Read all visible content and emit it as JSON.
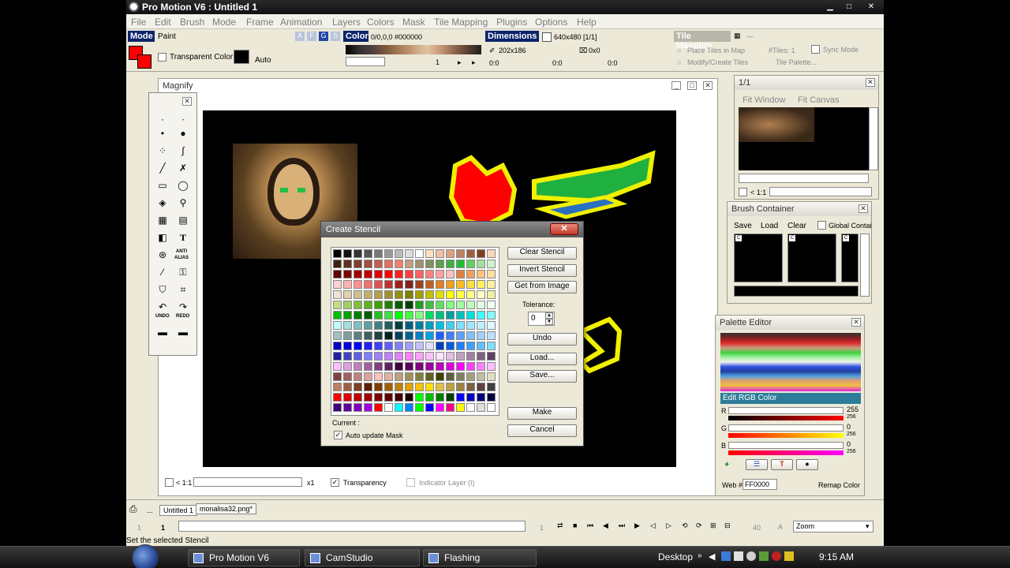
{
  "window": {
    "title": "Pro Motion V6 : Untitled 1",
    "min": "▁",
    "max": "□",
    "close": "✕"
  },
  "menu": [
    "File",
    "Edit",
    "Brush",
    "Mode",
    "Frame",
    "Animation",
    "Layers",
    "Colors",
    "Mask",
    "Tile Mapping",
    "Plugins",
    "Options",
    "Help"
  ],
  "toolbar": {
    "mode_label": "Mode",
    "mode_value": "Paint",
    "mode_letters": [
      "A",
      "F",
      "G",
      "S"
    ],
    "transparent_color_label": "Transparent Color:",
    "auto_label": "Auto",
    "color_label": "Color",
    "color_value": "0/0,0,0 #000000",
    "palette_index": "1",
    "dimensions_label": "Dimensions",
    "dimensions_value": "640x480 [1/1]",
    "brush_size": "202x186",
    "brush_offset": "0x0",
    "coord_a": "0:0",
    "coord_b": "0:0",
    "coord_c": "0:0",
    "tile_mapping_label": "Tile Mapping",
    "tile_dash": "—",
    "place_tiles": "Place Tiles in Map",
    "modify_tiles": "Modify/Create Tiles",
    "tiles_count": "#Tiles: 1",
    "tile_palette": "Tile Palette...",
    "sync_mode": "Sync Mode"
  },
  "magnify": {
    "title": "Magnify",
    "zoom_ratio": "< 1:1",
    "zoom_factor": "x1",
    "transparency_label": "Transparency",
    "indicator_label": "Indicator Layer (I)"
  },
  "tools": {
    "anti_alias_label": "ANTI ALIAS",
    "undo_label": "UNDO",
    "redo_label": "REDO",
    "text_icon": "T"
  },
  "stencil": {
    "title": "Create Stencil",
    "close": "✕",
    "buttons": {
      "clear": "Clear Stencil",
      "invert": "Invert Stencil",
      "get_image": "Get from Image",
      "undo": "Undo",
      "load": "Load...",
      "save": "Save...",
      "make": "Make",
      "cancel": "Cancel"
    },
    "tolerance_label": "Tolerance:",
    "tolerance_value": "0",
    "current_label": "Current :",
    "auto_update_label": "Auto update Mask"
  },
  "preview": {
    "title": "1/1",
    "fit_window": "Fit Window",
    "fit_canvas": "Fit Canvas",
    "zoom_ratio": "< 1:1"
  },
  "brush_container": {
    "title": "Brush Container",
    "save": "Save",
    "load": "Load",
    "clear": "Clear",
    "global": "Global Contai",
    "slot_marker": "C"
  },
  "palette_editor": {
    "title": "Palette Editor",
    "edit_rgb": "Edit RGB Color",
    "r_label": "R",
    "g_label": "G",
    "b_label": "B",
    "r_value": "255",
    "g_value": "0",
    "b_value": "0",
    "max_value": "256",
    "web_label": "Web #",
    "web_value": "FF0000",
    "remap_label": "Remap Color",
    "tool_icons": [
      "✦",
      "T",
      "●"
    ]
  },
  "status": {
    "tab_untitled": "Untitled 1",
    "tab_monalisa": "monalisa32.png*",
    "frame_start": "1",
    "frame_current": "1",
    "frame_next": "1",
    "frame_total": "40",
    "zoom_label": "Zoom",
    "message": "Set the selected Stencil"
  },
  "taskbar": {
    "tasks": [
      "Pro Motion V6",
      "CamStudio",
      "Flashing"
    ],
    "desktop": "Desktop",
    "time": "9:15 AM"
  },
  "colors": {
    "titlebar": "#1a1a1a",
    "selection_header": "#0a246a",
    "edit_rgb_bar": "#2d7d9a",
    "primary_color": "#ff0000"
  }
}
